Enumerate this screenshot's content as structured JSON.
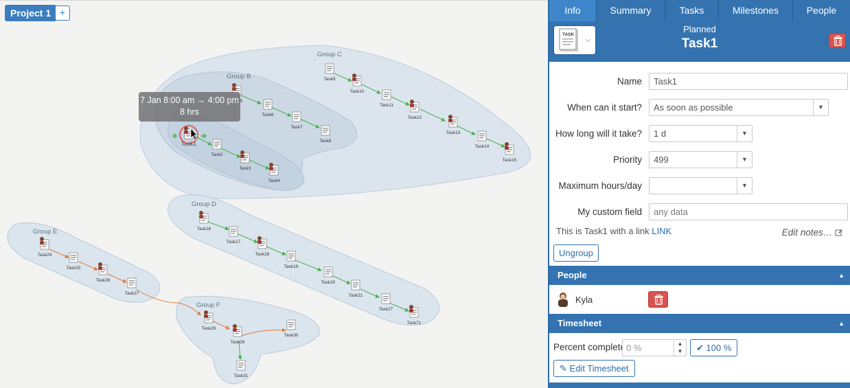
{
  "project_tab": {
    "label": "Project 1",
    "add_label": "+"
  },
  "tooltip": {
    "line1": "7 Jan 8:00 am → 4:00 pm",
    "line2": "8 hrs"
  },
  "groups": [
    {
      "label": "Group B"
    },
    {
      "label": "Group C"
    },
    {
      "label": "Group D"
    },
    {
      "label": "Group E"
    },
    {
      "label": "Group F"
    }
  ],
  "tasks": [
    "Task1",
    "Task2",
    "Task3",
    "Task4",
    "Task5",
    "Task6",
    "Task7",
    "Task8",
    "Task9",
    "Task10",
    "Task11",
    "Task12",
    "Task13",
    "Task14",
    "Task15",
    "Task16",
    "Task17",
    "Task18",
    "Task19",
    "Task20",
    "Task21",
    "Task27",
    "Task71",
    "Task24",
    "Task25",
    "Task26",
    "Task27",
    "Task28",
    "Task29",
    "Task30",
    "Task31"
  ],
  "panel": {
    "tabs": [
      "Info",
      "Summary",
      "Tasks",
      "Milestones",
      "People"
    ],
    "active_tab": "Info",
    "status": "Planned",
    "task_name": "Task1",
    "fields": {
      "name_label": "Name",
      "name_value": "Task1",
      "start_label": "When can it start?",
      "start_value": "As soon as possible",
      "duration_label": "How long will it take?",
      "duration_value": "1 d",
      "priority_label": "Priority",
      "priority_value": "499",
      "maxhours_label": "Maximum hours/day",
      "maxhours_value": "",
      "custom_label": "My custom field",
      "custom_placeholder": "any data"
    },
    "notes": {
      "text": "This is Task1 with a link",
      "link": "LINK",
      "edit_label": "Edit notes…"
    },
    "ungroup_label": "Ungroup",
    "people_section": {
      "title": "People",
      "person": "Kyla"
    },
    "timesheet_section": {
      "title": "Timesheet",
      "percent_label": "Percent complete",
      "percent_placeholder": "0 %",
      "full_label": "100 %",
      "edit_label": "Edit Timesheet"
    }
  },
  "colors": {
    "accent": "#3473b0",
    "danger": "#d9534f",
    "link_green": "#4caf50",
    "link_orange": "#e07b39"
  }
}
